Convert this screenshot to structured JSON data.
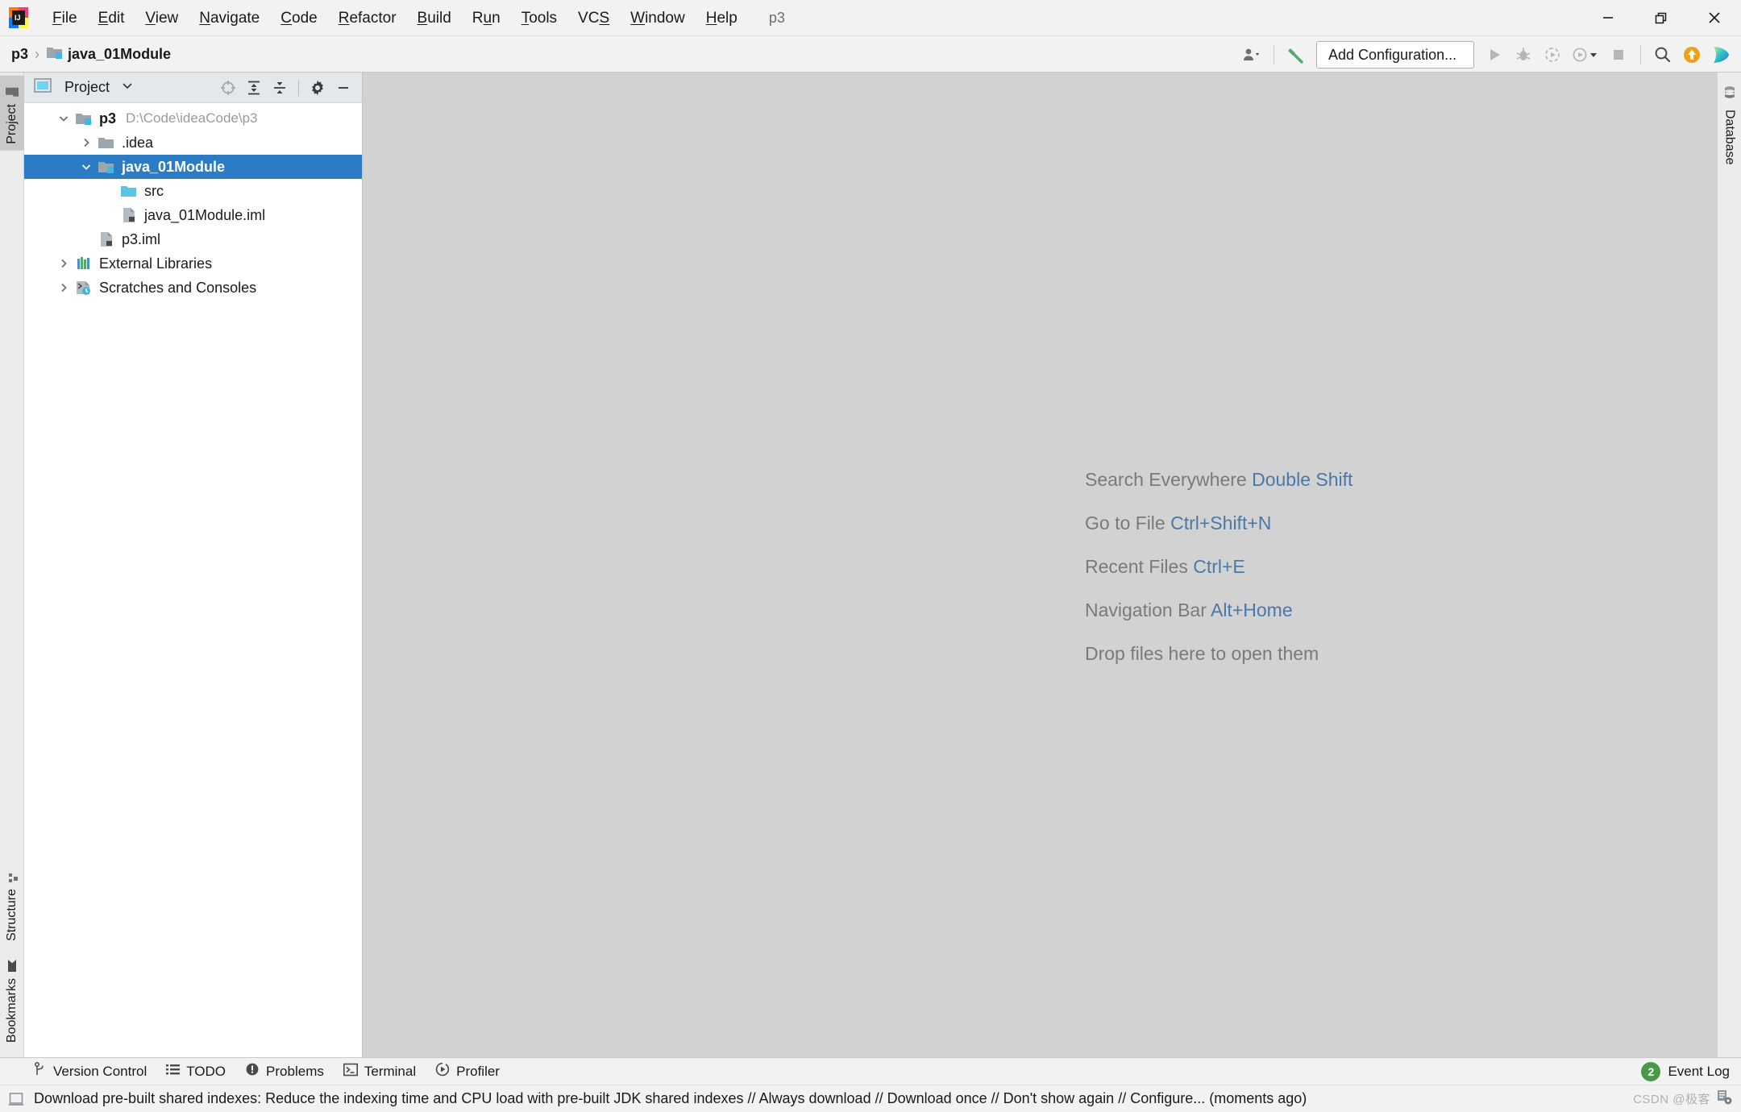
{
  "window": {
    "project_title": "p3",
    "controls": {
      "minimize": "minimize-icon",
      "restore": "restore-icon",
      "close": "close-icon"
    }
  },
  "menubar": {
    "logo": "intellij-idea-logo",
    "items": [
      {
        "label": "File",
        "mnemonic": "F"
      },
      {
        "label": "Edit",
        "mnemonic": "E"
      },
      {
        "label": "View",
        "mnemonic": "V"
      },
      {
        "label": "Navigate",
        "mnemonic": "N"
      },
      {
        "label": "Code",
        "mnemonic": "C"
      },
      {
        "label": "Refactor",
        "mnemonic": "R"
      },
      {
        "label": "Build",
        "mnemonic": "B"
      },
      {
        "label": "Run",
        "mnemonic": "u"
      },
      {
        "label": "Tools",
        "mnemonic": "T"
      },
      {
        "label": "VCS",
        "mnemonic": "S"
      },
      {
        "label": "Window",
        "mnemonic": "W"
      },
      {
        "label": "Help",
        "mnemonic": "H"
      }
    ]
  },
  "navbar": {
    "breadcrumb": [
      {
        "label": "p3",
        "icon": ""
      },
      {
        "label": "java_01Module",
        "icon": "module-folder-icon"
      }
    ],
    "separator": "›",
    "run_config_label": "Add Configuration...",
    "buttons": [
      {
        "name": "user-account-button",
        "icon": "user-icon"
      },
      {
        "name": "build-hammer-button",
        "icon": "hammer-icon"
      },
      {
        "name": "run-button",
        "icon": "run-triangle-icon"
      },
      {
        "name": "debug-button",
        "icon": "debug-bug-icon"
      },
      {
        "name": "run-with-coverage-button",
        "icon": "coverage-icon"
      },
      {
        "name": "profile-button",
        "icon": "profiler-icon"
      },
      {
        "name": "stop-button",
        "icon": "stop-square-icon"
      },
      {
        "name": "search-everywhere-button",
        "icon": "search-icon"
      },
      {
        "name": "update-project-button",
        "icon": "orange-arrow-up-icon"
      },
      {
        "name": "ide-assistant-button",
        "icon": "gradient-play-icon"
      }
    ]
  },
  "stripes": {
    "left_top": [
      {
        "label": "Project",
        "icon": "project-folder-icon",
        "active": true
      }
    ],
    "left_bottom": [
      {
        "label": "Structure",
        "icon": "structure-icon"
      },
      {
        "label": "Bookmarks",
        "icon": "bookmark-icon"
      }
    ],
    "right": [
      {
        "label": "Database",
        "icon": "database-cylinder-icon"
      }
    ]
  },
  "project_panel": {
    "title": "Project",
    "view_selector_icon": "chevron-down-icon",
    "actions": [
      {
        "name": "select-opened-file-button",
        "icon": "crosshair-icon"
      },
      {
        "name": "expand-all-button",
        "icon": "expand-all-icon"
      },
      {
        "name": "collapse-all-button",
        "icon": "collapse-all-icon"
      },
      {
        "name": "panel-settings-button",
        "icon": "gear-icon"
      },
      {
        "name": "hide-panel-button",
        "icon": "minimize-icon"
      }
    ],
    "tree": [
      {
        "label": "p3",
        "path": "D:\\Code\\ideaCode\\p3",
        "indent": 0,
        "twisty": "expanded",
        "icon": "module-folder-icon",
        "bold": true,
        "selected": false
      },
      {
        "label": ".idea",
        "path": "",
        "indent": 1,
        "twisty": "collapsed",
        "icon": "folder-icon",
        "bold": false,
        "selected": false
      },
      {
        "label": "java_01Module",
        "path": "",
        "indent": 1,
        "twisty": "expanded",
        "icon": "module-folder-icon",
        "bold": true,
        "selected": true
      },
      {
        "label": "src",
        "path": "",
        "indent": 2,
        "twisty": "none",
        "icon": "source-folder-icon",
        "bold": false,
        "selected": false
      },
      {
        "label": "java_01Module.iml",
        "path": "",
        "indent": 2,
        "twisty": "none",
        "icon": "iml-file-icon",
        "bold": false,
        "selected": false
      },
      {
        "label": "p3.iml",
        "path": "",
        "indent": 1,
        "twisty": "none",
        "icon": "iml-file-icon",
        "bold": false,
        "selected": false
      },
      {
        "label": "External Libraries",
        "path": "",
        "indent": 0,
        "twisty": "collapsed",
        "icon": "libraries-icon",
        "bold": false,
        "selected": false
      },
      {
        "label": "Scratches and Consoles",
        "path": "",
        "indent": 0,
        "twisty": "collapsed",
        "icon": "scratches-icon",
        "bold": false,
        "selected": false
      }
    ]
  },
  "editor": {
    "empty_lines": [
      {
        "action": "Search Everywhere",
        "shortcut": "Double Shift"
      },
      {
        "action": "Go to File",
        "shortcut": "Ctrl+Shift+N"
      },
      {
        "action": "Recent Files",
        "shortcut": "Ctrl+E"
      },
      {
        "action": "Navigation Bar",
        "shortcut": "Alt+Home"
      },
      {
        "action": "Drop files here to open them",
        "shortcut": ""
      }
    ]
  },
  "toolwindow_bar": {
    "buttons": [
      {
        "label": "Version Control",
        "icon": "branch-icon"
      },
      {
        "label": "TODO",
        "icon": "list-icon"
      },
      {
        "label": "Problems",
        "icon": "exclamation-circle-icon"
      },
      {
        "label": "Terminal",
        "icon": "terminal-icon"
      },
      {
        "label": "Profiler",
        "icon": "profiler-icon"
      }
    ],
    "event_log": {
      "label": "Event Log",
      "count": "2"
    }
  },
  "statusbar": {
    "icon": "notification-icon",
    "message": "Download pre-built shared indexes: Reduce the indexing time and CPU load with pre-built JDK shared indexes // Always download // Download once // Don't show again // Configure... (moments ago)",
    "watermark": "CSDN @极客"
  },
  "colors": {
    "selection_blue": "#2b7cc4",
    "link_blue": "#4a78a8",
    "editor_bg": "#d2d2d2",
    "chrome_bg": "#f2f2f2",
    "panel_head_bg": "#e5e8eb",
    "badge_green": "#479a47",
    "accent_orange": "#f0a016"
  }
}
